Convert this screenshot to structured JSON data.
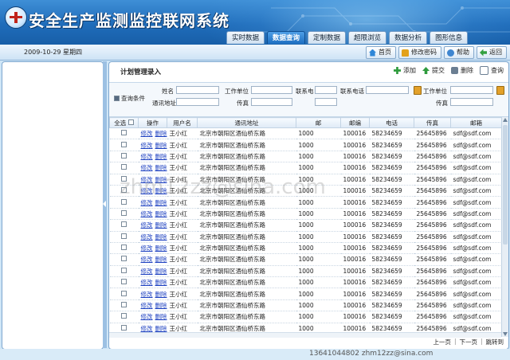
{
  "app": {
    "title": "安全生产监测监控联网系统"
  },
  "tabs": [
    {
      "label": "实时数据",
      "active": false
    },
    {
      "label": "数据查询",
      "active": true
    },
    {
      "label": "定制数据",
      "active": false
    },
    {
      "label": "超限浏览",
      "active": false
    },
    {
      "label": "数据分析",
      "active": false
    },
    {
      "label": "图形信息",
      "active": false
    }
  ],
  "subbar": {
    "date": "2009-10-29 星期四",
    "buttons": [
      {
        "label": "首页",
        "icon": "home-icon"
      },
      {
        "label": "修改密码",
        "icon": "lock-icon"
      },
      {
        "label": "帮助",
        "icon": "help-icon"
      },
      {
        "label": "返回",
        "icon": "back-icon"
      }
    ]
  },
  "main": {
    "title": "计划管理录入",
    "actions": [
      {
        "label": "添加",
        "icon": "add-icon"
      },
      {
        "label": "提交",
        "icon": "submit-icon"
      },
      {
        "label": "删除",
        "icon": "delete-icon"
      },
      {
        "label": "查询",
        "icon": "query-icon"
      }
    ]
  },
  "query": {
    "label": "查询条件",
    "fields": {
      "name": "姓名",
      "org": "工作单位",
      "contact": "联系电",
      "contact_phone": "联系电话",
      "org2": "工作单位",
      "address": "通讯地址",
      "fax": "传真",
      "fax2": "传真"
    }
  },
  "table": {
    "headers": [
      "全选",
      "操作",
      "用户名",
      "通讯地址",
      "邮",
      "邮编",
      "电话",
      "传真",
      "邮箱"
    ],
    "edit_label": "修改",
    "delete_label": "删除",
    "rows": [
      {
        "user": "王小红",
        "address": "北京市朝阳区酒仙桥东路",
        "n": "1000",
        "zip": "100016",
        "phone": "58234659",
        "fax": "25645896",
        "email": "sdf@sdf.com"
      },
      {
        "user": "王小红",
        "address": "北京市朝阳区酒仙桥东路",
        "n": "1000",
        "zip": "100016",
        "phone": "58234659",
        "fax": "25645896",
        "email": "sdf@sdf.com"
      },
      {
        "user": "王小红",
        "address": "北京市朝阳区酒仙桥东路",
        "n": "1000",
        "zip": "100016",
        "phone": "58234659",
        "fax": "25645896",
        "email": "sdf@sdf.com"
      },
      {
        "user": "王小红",
        "address": "北京市朝阳区酒仙桥东路",
        "n": "1000",
        "zip": "100016",
        "phone": "58234659",
        "fax": "25645896",
        "email": "sdf@sdf.com"
      },
      {
        "user": "王小红",
        "address": "北京市朝阳区酒仙桥东路",
        "n": "1000",
        "zip": "100016",
        "phone": "58234659",
        "fax": "25645896",
        "email": "sdf@sdf.com"
      },
      {
        "user": "王小红",
        "address": "北京市朝阳区酒仙桥东路",
        "n": "1000",
        "zip": "100016",
        "phone": "58234659",
        "fax": "25645896",
        "email": "sdf@sdf.com"
      },
      {
        "user": "王小红",
        "address": "北京市朝阳区酒仙桥东路",
        "n": "1000",
        "zip": "100016",
        "phone": "58234659",
        "fax": "25645896",
        "email": "sdf@sdf.com"
      },
      {
        "user": "王小红",
        "address": "北京市朝阳区酒仙桥东路",
        "n": "1000",
        "zip": "100016",
        "phone": "58234659",
        "fax": "25645896",
        "email": "sdf@sdf.com"
      },
      {
        "user": "王小红",
        "address": "北京市朝阳区酒仙桥东路",
        "n": "1000",
        "zip": "100016",
        "phone": "58234659",
        "fax": "25645896",
        "email": "sdf@sdf.com"
      },
      {
        "user": "王小红",
        "address": "北京市朝阳区酒仙桥东路",
        "n": "1000",
        "zip": "100016",
        "phone": "58234659",
        "fax": "25645896",
        "email": "sdf@sdf.com"
      },
      {
        "user": "王小红",
        "address": "北京市朝阳区酒仙桥东路",
        "n": "1000",
        "zip": "100016",
        "phone": "58234659",
        "fax": "25645896",
        "email": "sdf@sdf.com"
      },
      {
        "user": "王小红",
        "address": "北京市朝阳区酒仙桥东路",
        "n": "1000",
        "zip": "100016",
        "phone": "58234659",
        "fax": "25645896",
        "email": "sdf@sdf.com"
      },
      {
        "user": "王小红",
        "address": "北京市朝阳区酒仙桥东路",
        "n": "1000",
        "zip": "100016",
        "phone": "58234659",
        "fax": "25645896",
        "email": "sdf@sdf.com"
      },
      {
        "user": "王小红",
        "address": "北京市朝阳区酒仙桥东路",
        "n": "1000",
        "zip": "100016",
        "phone": "58234659",
        "fax": "25645896",
        "email": "sdf@sdf.com"
      },
      {
        "user": "王小红",
        "address": "北京市朝阳区酒仙桥东路",
        "n": "1000",
        "zip": "100016",
        "phone": "58234659",
        "fax": "25645896",
        "email": "sdf@sdf.com"
      },
      {
        "user": "王小红",
        "address": "北京市朝阳区酒仙桥东路",
        "n": "1000",
        "zip": "100016",
        "phone": "58234659",
        "fax": "25645896",
        "email": "sdf@sdf.com"
      },
      {
        "user": "王小红",
        "address": "北京市朝阳区酒仙桥东路",
        "n": "1000",
        "zip": "100016",
        "phone": "58234659",
        "fax": "25645896",
        "email": "sdf@sdf.com"
      },
      {
        "user": "王小红",
        "address": "北京市朝阳区酒仙桥东路",
        "n": "1000",
        "zip": "100016",
        "phone": "58234659",
        "fax": "25645896",
        "email": "sdf@sdf.com"
      },
      {
        "user": "王小红",
        "address": "北京市朝阳区酒仙桥东路",
        "n": "1000",
        "zip": "100016",
        "phone": "58234659",
        "fax": "25645896",
        "email": "sdf@sdf.com"
      }
    ]
  },
  "pager": {
    "prev": "上一页",
    "next": "下一页",
    "jump": "跳转到"
  },
  "footer": {
    "text": "13641044802 zhm12zz@sina.com"
  },
  "watermark": {
    "text": "zhm12zz@sina.com"
  }
}
